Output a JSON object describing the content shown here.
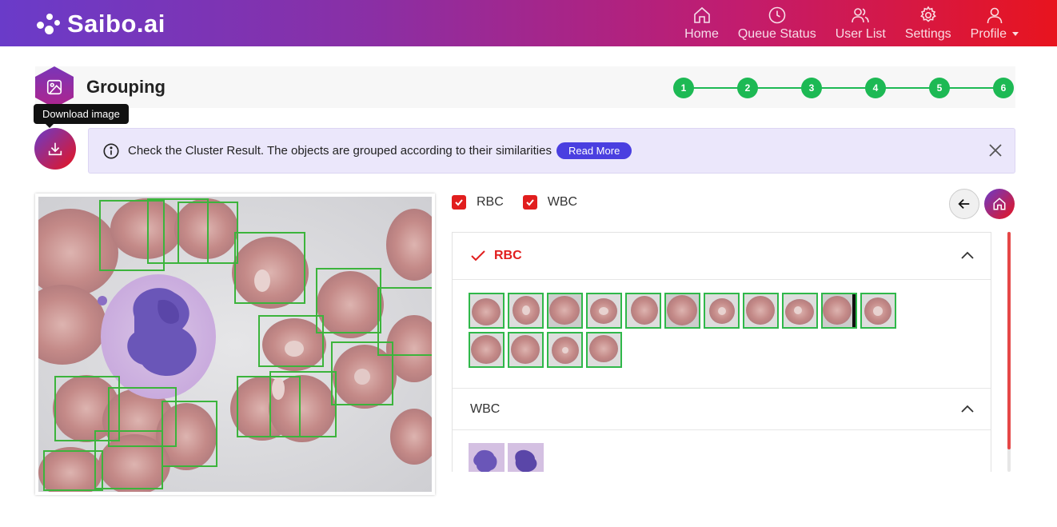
{
  "app": {
    "logo_text": "Saibo.ai"
  },
  "nav": [
    {
      "label": "Home",
      "icon": "home-icon"
    },
    {
      "label": "Queue Status",
      "icon": "clock-icon"
    },
    {
      "label": "User List",
      "icon": "users-icon"
    },
    {
      "label": "Settings",
      "icon": "gear-icon"
    },
    {
      "label": "Profile",
      "icon": "user-icon"
    }
  ],
  "page": {
    "title": "Grouping",
    "icon": "image-icon"
  },
  "stepper": {
    "steps": [
      "1",
      "2",
      "3",
      "4",
      "5",
      "6"
    ],
    "color": "#1db954"
  },
  "tooltip": {
    "text": "Download image"
  },
  "info": {
    "text": "Check the Cluster Result. The objects are grouped according to their similarities",
    "read_more": "Read More"
  },
  "filters": [
    {
      "label": "RBC",
      "checked": true
    },
    {
      "label": "WBC",
      "checked": true
    }
  ],
  "groups": {
    "rbc": {
      "title": "RBC",
      "count": 15,
      "selected": true
    },
    "wbc": {
      "title": "WBC",
      "count": 2
    }
  },
  "colors": {
    "accent_red": "#e11e1e",
    "box_green": "#3cb43c",
    "read_more_blue": "#4a3fe0",
    "info_bg": "#ebe7fb"
  }
}
